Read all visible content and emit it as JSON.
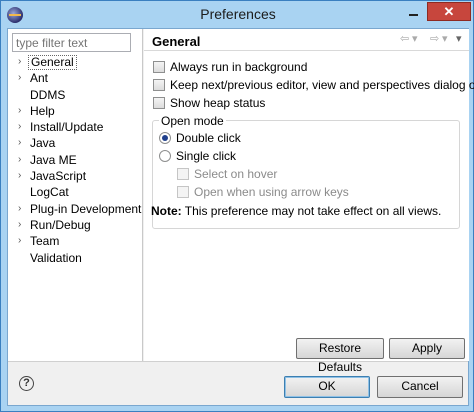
{
  "window": {
    "title": "Preferences"
  },
  "filter": {
    "placeholder": "type filter text"
  },
  "tree": [
    {
      "label": "General",
      "expandable": true,
      "selected": true
    },
    {
      "label": "Ant",
      "expandable": true
    },
    {
      "label": "DDMS",
      "expandable": false
    },
    {
      "label": "Help",
      "expandable": true
    },
    {
      "label": "Install/Update",
      "expandable": true
    },
    {
      "label": "Java",
      "expandable": true
    },
    {
      "label": "Java ME",
      "expandable": true
    },
    {
      "label": "JavaScript",
      "expandable": true
    },
    {
      "label": "LogCat",
      "expandable": false
    },
    {
      "label": "Plug-in Development",
      "expandable": true
    },
    {
      "label": "Run/Debug",
      "expandable": true
    },
    {
      "label": "Team",
      "expandable": true
    },
    {
      "label": "Validation",
      "expandable": false
    }
  ],
  "page": {
    "title": "General",
    "options": {
      "always_run_background": "Always run in background",
      "keep_next_previous": "Keep next/previous editor, view and perspectives dialog open",
      "show_heap_status": "Show heap status"
    },
    "open_mode": {
      "label": "Open mode",
      "double_click": "Double click",
      "single_click": "Single click",
      "select_on_hover": "Select on hover",
      "open_arrow_keys": "Open when using arrow keys"
    },
    "note_label": "Note:",
    "note_text": "This preference may not take effect on all views."
  },
  "buttons": {
    "restore_defaults": "Restore Defaults",
    "apply": "Apply",
    "ok": "OK",
    "cancel": "Cancel",
    "help": "?"
  },
  "window_controls": {
    "close": "✕"
  }
}
